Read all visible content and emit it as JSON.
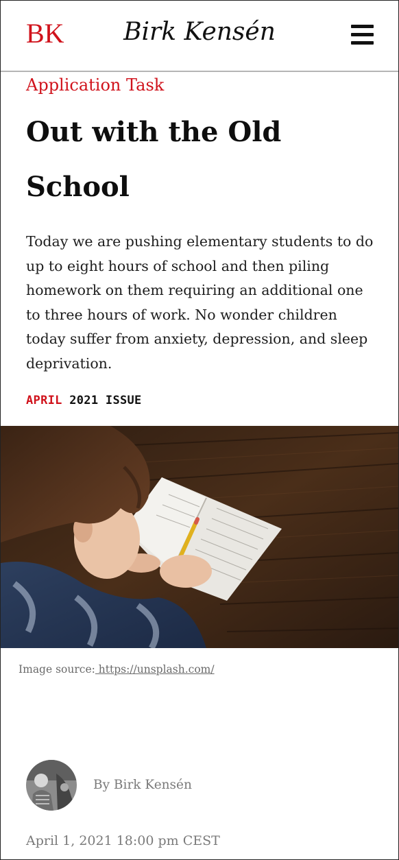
{
  "header": {
    "logo": "BK",
    "site_title": "Birk Kensén",
    "menu_icon": "hamburger-menu-icon"
  },
  "article": {
    "category": "Application Task",
    "title": "Out with the Old School",
    "lede": "Today we are pushing elementary students to do up to eight hours of school and then piling homework on them requiring an additional one to three hours of work. No wonder children today suffer from anxiety, depression, and sleep deprivation.",
    "issue": {
      "month": "APRIL",
      "rest": "2021 ISSUE"
    },
    "image": {
      "caption_prefix": "Image source:",
      "caption_link": " https://unsplash.com/"
    },
    "author": {
      "byline": "By Birk Kensén",
      "date": "April 1, 2021 18:00 pm CEST"
    }
  },
  "colors": {
    "accent": "#d0121b",
    "text": "#111111",
    "muted": "#7a7a7a"
  }
}
